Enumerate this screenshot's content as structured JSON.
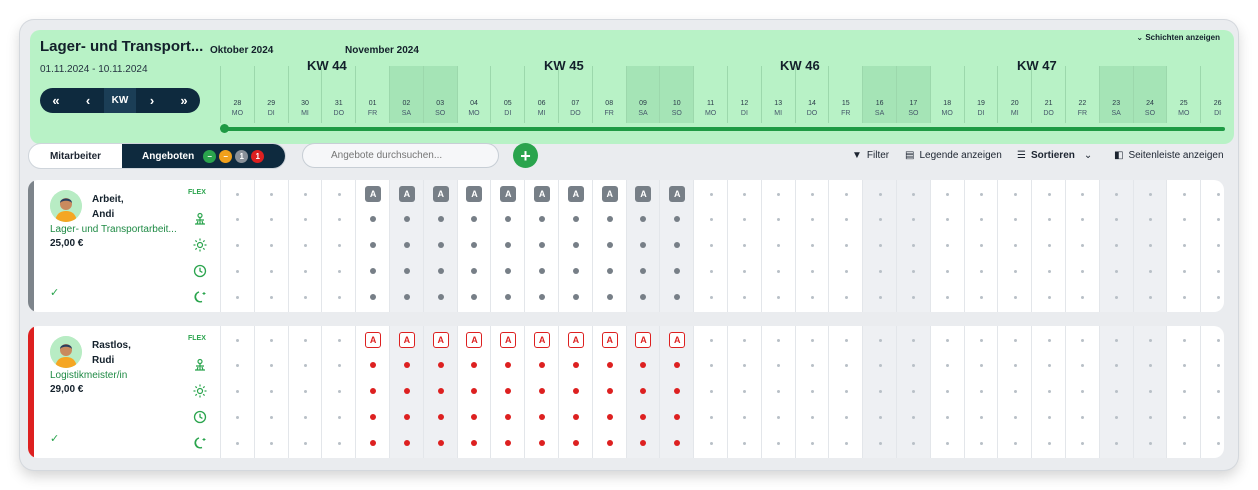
{
  "header": {
    "title": "Lager- und Transport...",
    "range": "01.11.2024 - 10.11.2024",
    "show_shifts": "Schichten anzeigen",
    "nav": {
      "first": "«",
      "prev": "‹",
      "mode": "KW",
      "next": "›",
      "last": "»"
    },
    "months": [
      "Oktober 2024",
      "November 2024"
    ],
    "weeks": [
      "KW 44",
      "KW 45",
      "KW 46",
      "KW 47"
    ],
    "days": [
      {
        "n": "28",
        "d": "MO",
        "we": false
      },
      {
        "n": "29",
        "d": "DI",
        "we": false
      },
      {
        "n": "30",
        "d": "MI",
        "we": false
      },
      {
        "n": "31",
        "d": "DO",
        "we": false
      },
      {
        "n": "01",
        "d": "FR",
        "we": false
      },
      {
        "n": "02",
        "d": "SA",
        "we": true
      },
      {
        "n": "03",
        "d": "SO",
        "we": true
      },
      {
        "n": "04",
        "d": "MO",
        "we": false
      },
      {
        "n": "05",
        "d": "DI",
        "we": false
      },
      {
        "n": "06",
        "d": "MI",
        "we": false
      },
      {
        "n": "07",
        "d": "DO",
        "we": false
      },
      {
        "n": "08",
        "d": "FR",
        "we": false
      },
      {
        "n": "09",
        "d": "SA",
        "we": true
      },
      {
        "n": "10",
        "d": "SO",
        "we": true
      },
      {
        "n": "11",
        "d": "MO",
        "we": false
      },
      {
        "n": "12",
        "d": "DI",
        "we": false
      },
      {
        "n": "13",
        "d": "MI",
        "we": false
      },
      {
        "n": "14",
        "d": "DO",
        "we": false
      },
      {
        "n": "15",
        "d": "FR",
        "we": false
      },
      {
        "n": "16",
        "d": "SA",
        "we": true
      },
      {
        "n": "17",
        "d": "SO",
        "we": true
      },
      {
        "n": "18",
        "d": "MO",
        "we": false
      },
      {
        "n": "19",
        "d": "DI",
        "we": false
      },
      {
        "n": "20",
        "d": "MI",
        "we": false
      },
      {
        "n": "21",
        "d": "DO",
        "we": false
      },
      {
        "n": "22",
        "d": "FR",
        "we": false
      },
      {
        "n": "23",
        "d": "SA",
        "we": true
      },
      {
        "n": "24",
        "d": "SO",
        "we": true
      },
      {
        "n": "25",
        "d": "MO",
        "we": false
      },
      {
        "n": "26",
        "d": "DI",
        "we": false
      }
    ]
  },
  "toolbar": {
    "tab_employees": "Mitarbeiter",
    "tab_offers": "Angeboten",
    "badges": [
      {
        "text": "–",
        "color": "#2aa44d"
      },
      {
        "text": "–",
        "color": "#f0a01c"
      },
      {
        "text": "1",
        "color": "#8a9199"
      },
      {
        "text": "1",
        "color": "#dd2020"
      }
    ],
    "search_placeholder": "Angebote durchsuchen...",
    "add": "+",
    "filter": "Filter",
    "legend": "Legende anzeigen",
    "sort": "Sortieren",
    "sidebar": "Seitenleiste anzeigen"
  },
  "row_labels": {
    "flex": "FLEX"
  },
  "absence_letter": "A",
  "employees": [
    {
      "name_line1": "Arbeit,",
      "name_line2": "Andi",
      "role": "Lager- und Transportarbeit...",
      "rate": "25,00 €",
      "check": "✓",
      "accent": "#7d848b",
      "mark": "gray",
      "offer_start": 4,
      "offer_end": 13
    },
    {
      "name_line1": "Rastlos,",
      "name_line2": "Rudi",
      "role": "Logistikmeister/in",
      "rate": "29,00 €",
      "check": "✓",
      "accent": "#dd2020",
      "mark": "red",
      "offer_start": 4,
      "offer_end": 13
    }
  ]
}
